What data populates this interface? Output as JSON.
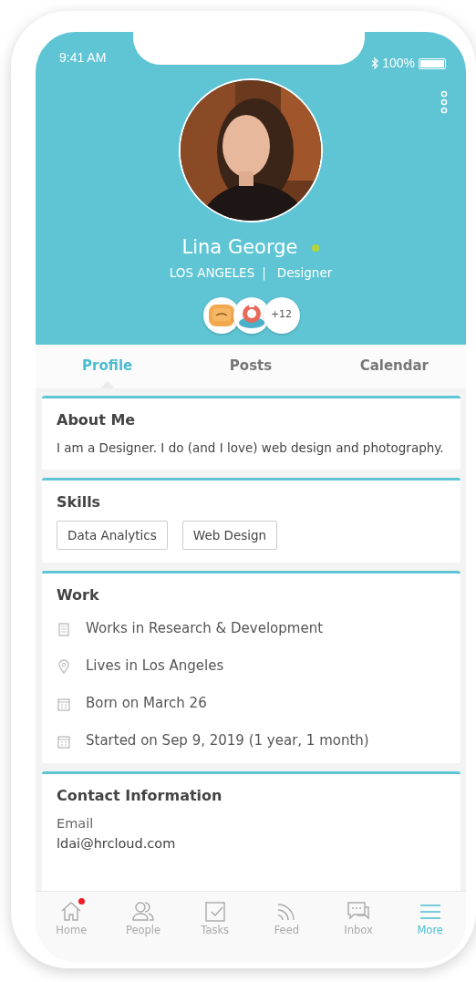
{
  "status_bar": {
    "time": "9:41 AM",
    "battery": "100%"
  },
  "profile": {
    "name": "Lina George",
    "online": true,
    "city": "LOS ANGELES",
    "separator": "|",
    "role": "Designer",
    "badge_more": "+12"
  },
  "tabs": [
    {
      "label": "Profile",
      "selected": true
    },
    {
      "label": "Posts",
      "selected": false
    },
    {
      "label": "Calendar",
      "selected": false
    }
  ],
  "about": {
    "title": "About Me",
    "text": "I am a Designer. I do (and I love) web design and photography."
  },
  "skills": {
    "title": "Skills",
    "items": [
      "Data Analytics",
      "Web Design"
    ]
  },
  "work": {
    "title": "Work",
    "items": [
      {
        "kind": "building",
        "text": "Works in Research & Development"
      },
      {
        "kind": "pin",
        "text": "Lives in Los Angeles"
      },
      {
        "kind": "calendar",
        "text": "Born on March 26"
      },
      {
        "kind": "calendar",
        "text": "Started on Sep 9, 2019 (1 year, 1 month)"
      }
    ]
  },
  "contact": {
    "title": "Contact Information",
    "fields": [
      {
        "label": "Email",
        "value": "ldai@hrcloud.com"
      }
    ]
  },
  "bottom_nav": [
    {
      "kind": "home",
      "label": "Home",
      "selected": false,
      "notification": true
    },
    {
      "kind": "people",
      "label": "People",
      "selected": false,
      "notification": false
    },
    {
      "kind": "tasks",
      "label": "Tasks",
      "selected": false,
      "notification": false
    },
    {
      "kind": "feed",
      "label": "Feed",
      "selected": false,
      "notification": false
    },
    {
      "kind": "inbox",
      "label": "Inbox",
      "selected": false,
      "notification": false
    },
    {
      "kind": "more",
      "label": "More",
      "selected": true,
      "notification": false
    }
  ]
}
